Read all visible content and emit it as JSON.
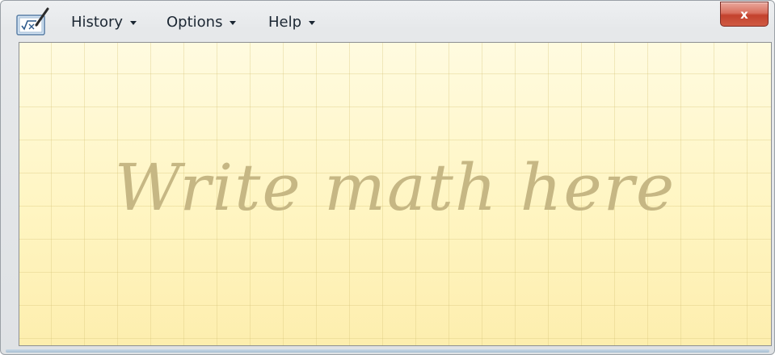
{
  "titlebar": {
    "app_icon": "math-input-panel-icon",
    "close_label": "x"
  },
  "menu": {
    "history": "History",
    "options": "Options",
    "help": "Help"
  },
  "canvas": {
    "prompt": "Write math here"
  },
  "colors": {
    "canvas_background": "#fff6c4",
    "grid_line": "#e9dca0",
    "prompt_text": "#c6b784",
    "close_button": "#c3412d"
  }
}
